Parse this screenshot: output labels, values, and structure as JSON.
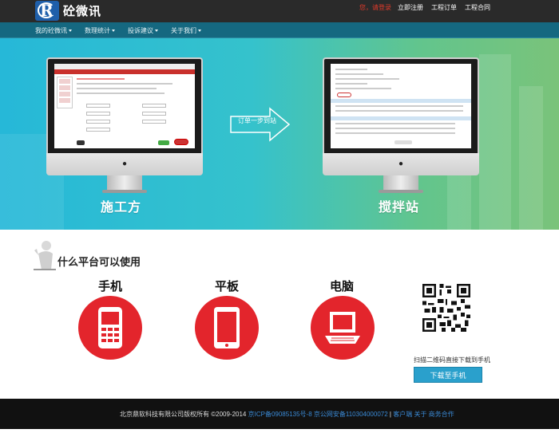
{
  "header": {
    "logo_text": "砼微讯",
    "greeting": "您，请登录",
    "links": [
      "立即注册",
      "工程订单",
      "工程合同"
    ]
  },
  "nav": {
    "items": [
      {
        "label": "我的砼微讯"
      },
      {
        "label": "数理统计"
      },
      {
        "label": "投诉建议"
      },
      {
        "label": "关于我们"
      }
    ]
  },
  "hero": {
    "left_label": "施工方",
    "right_label": "搅拌站",
    "arrow_text": "订单一步到站"
  },
  "platforms": {
    "title": "什么平台可以使用",
    "devices": [
      {
        "label": "手机",
        "icon": "phone-icon"
      },
      {
        "label": "平板",
        "icon": "tablet-icon"
      },
      {
        "label": "电脑",
        "icon": "laptop-icon"
      }
    ],
    "qr_caption": "扫描二维码直接下载到手机",
    "download_label": "下载至手机"
  },
  "footer": {
    "copyright": "北京鼎软科技有限公司版权所有 ©2009-2014",
    "icp": "京ICP备09085135号-8 京公网安备110304000072",
    "separator": "|",
    "links": "客户端 关于 商务合作"
  },
  "colors": {
    "topbar": "#2a2a2a",
    "nav": "#156880",
    "accent_red": "#e3252c",
    "download_blue": "#2aa0cc"
  }
}
